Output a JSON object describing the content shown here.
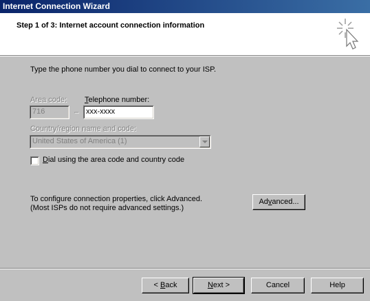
{
  "window": {
    "title": "Internet Connection Wizard"
  },
  "header": {
    "step_title": "Step 1 of 3: Internet account connection information",
    "icon": "wizard-sparkle-cursor-icon"
  },
  "content": {
    "intro": "Type the phone number you dial to connect to your ISP.",
    "area_code_label": "Area code:",
    "area_code_value": "716",
    "dash": "–",
    "telephone_label_ul": "T",
    "telephone_label_rest": "elephone number:",
    "telephone_value": "xxx-xxxx",
    "country_label": "Country/region name and code:",
    "country_value": "United States of America (1)",
    "dial_checkbox_ul": "D",
    "dial_checkbox_rest": "ial using the area code and country code",
    "dial_checkbox_checked": false,
    "advanced_text_line1": "To configure connection properties, click Advanced.",
    "advanced_text_line2": "(Most ISPs do not require advanced settings.)",
    "advanced_button_pre": "Ad",
    "advanced_button_ul": "v",
    "advanced_button_post": "anced..."
  },
  "footer": {
    "back_pre": "< ",
    "back_ul": "B",
    "back_post": "ack",
    "next_ul": "N",
    "next_post": "ext >",
    "cancel": "Cancel",
    "help": "Help"
  },
  "colors": {
    "titlebar_start": "#0a246a",
    "titlebar_end": "#3a6ea5",
    "face": "#c0c0c0"
  }
}
